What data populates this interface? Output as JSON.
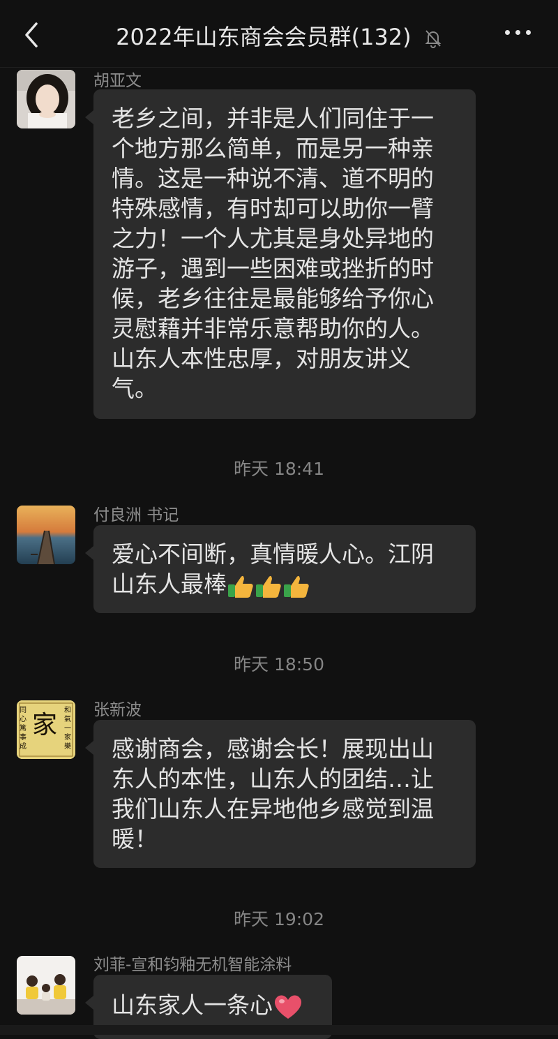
{
  "header": {
    "title": "2022年山东商会会员群(132)",
    "back_icon": "chevron-left-icon",
    "mute_icon": "bell-slash-icon",
    "more_icon": "more-dots-icon"
  },
  "messages": [
    {
      "sender": "胡亚文",
      "lines": [
        "老乡之间，并非是人们同住于一",
        "个地方那么简单，而是另一种亲",
        "情。这是一种说不清、道不明的",
        "特殊感情，有时却可以助你一臂",
        "之力！一个人尤其是身处异地的",
        "游子，遇到一些困难或挫折的时",
        "候，老乡往往是最能够给予你心",
        "灵慰藉并非常乐意帮助你的人。",
        "山东人本性忠厚，对朋友讲义",
        "气。"
      ]
    },
    {
      "time": "昨天 18:41",
      "sender": "付良洲 书记",
      "lines": [
        "爱心不间断，真情暖人心。江阴",
        "山东人最棒"
      ],
      "emoji": "thumbs-up-icon"
    },
    {
      "time": "昨天 18:50",
      "sender": "张新波",
      "avatar_text": {
        "main": "家",
        "left": "同心篤事成",
        "right": "和氣一家樂"
      },
      "lines": [
        "感谢商会，感谢会长！展现出山",
        "东人的本性，山东人的团结…让",
        "我们山东人在异地他乡感觉到温",
        "暖！"
      ]
    },
    {
      "time": "昨天 19:02",
      "sender": "刘菲-宣和钧釉无机智能涂料",
      "lines": [
        "山东家人一条心"
      ],
      "emoji": "red-heart-icon"
    }
  ],
  "colors": {
    "background": "#111111",
    "bubble": "#2c2c2c",
    "text": "#e4e4e4",
    "muted": "#8c8c8c"
  }
}
